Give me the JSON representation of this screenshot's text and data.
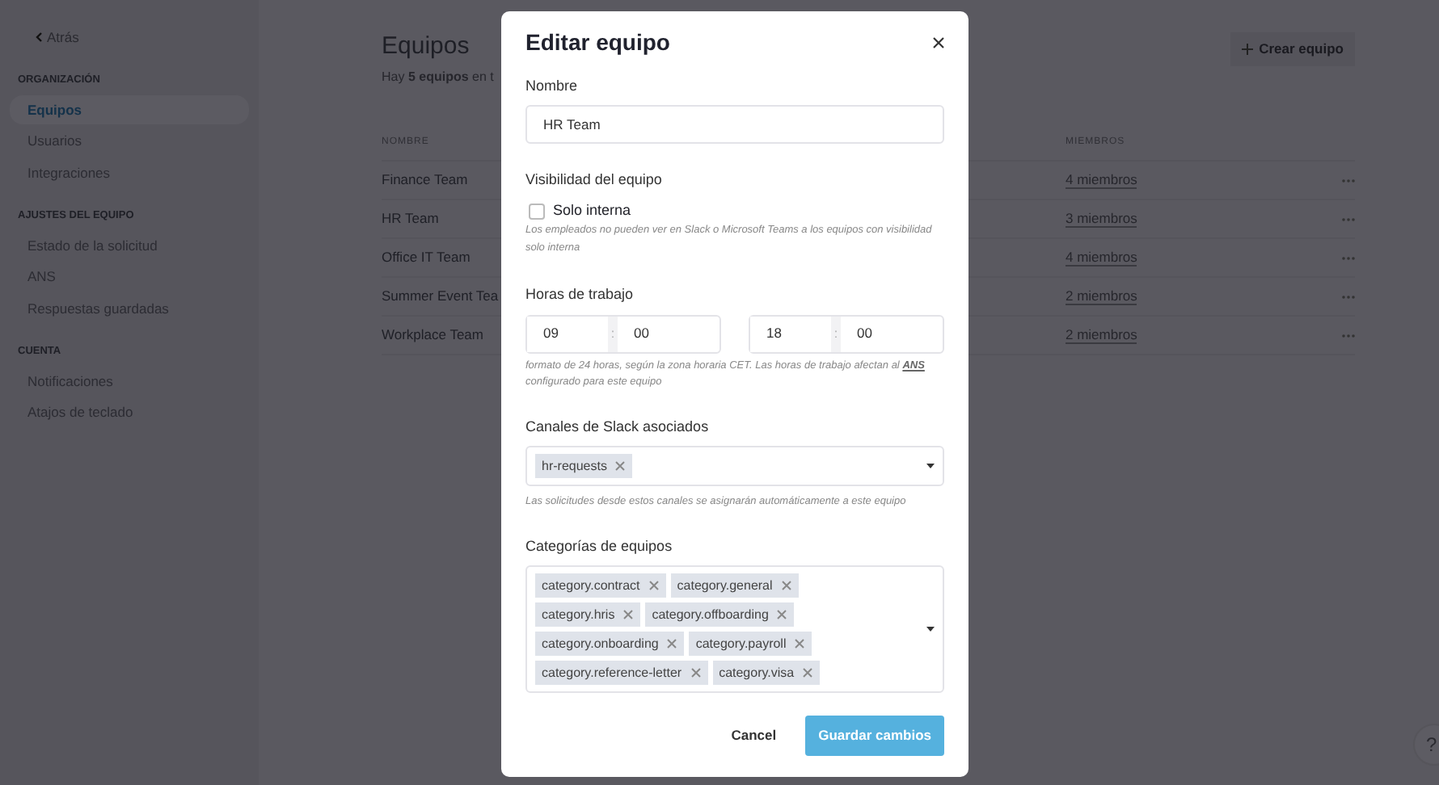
{
  "sidebar": {
    "back": "Atrás",
    "sections": [
      {
        "title": "ORGANIZACIÓN",
        "items": [
          {
            "label": "Equipos",
            "selected": true
          },
          {
            "label": "Usuarios",
            "selected": false
          },
          {
            "label": "Integraciones",
            "selected": false
          }
        ]
      },
      {
        "title": "AJUSTES DEL EQUIPO",
        "items": [
          {
            "label": "Estado de la solicitud",
            "selected": false
          },
          {
            "label": "ANS",
            "selected": false
          },
          {
            "label": "Respuestas guardadas",
            "selected": false
          }
        ]
      },
      {
        "title": "CUENTA",
        "items": [
          {
            "label": "Notificaciones",
            "selected": false
          },
          {
            "label": "Atajos de teclado",
            "selected": false
          }
        ]
      }
    ]
  },
  "main": {
    "title": "Equipos",
    "subtitle": "Hay **5 equipos** en t",
    "create_button": "Crear equipo",
    "table": {
      "columns": [
        "NOMBRE",
        "MIEMBROS"
      ],
      "rows": [
        {
          "name": "Finance Team",
          "members": "4 miembros"
        },
        {
          "name": "HR Team",
          "members": "3 miembros"
        },
        {
          "name": "Office IT Team",
          "members": "4 miembros"
        },
        {
          "name": "Summer Event Tea",
          "members": "2 miembros"
        },
        {
          "name": "Workplace Team",
          "members": "2 miembros"
        }
      ]
    }
  },
  "help_button": "?",
  "modal": {
    "title": "Editar equipo",
    "name_label": "Nombre",
    "name_value": "HR Team",
    "visibility_label": "Visibilidad del equipo",
    "internal_only": {
      "label": "Solo interna",
      "checked": false
    },
    "visibility_help": "Los empleados no pueden ver en Slack o Microsoft Teams a los equipos con visibilidad solo interna",
    "hours_label": "Horas de trabajo",
    "start": {
      "hour": "09",
      "separator": ":",
      "minute": "00"
    },
    "end": {
      "hour": "18",
      "separator": ":",
      "minute": "00"
    },
    "hours_help": {
      "before": "formato de 24 horas, según la zona horaria CET. Las horas de trabajo afectan al ",
      "link": "ANS",
      "after": " configurado para este equipo"
    },
    "slack_label": "Canales de Slack asociados",
    "slack_channels": [
      "hr-requests"
    ],
    "slack_help": "Las solicitudes desde estos canales se asignarán automáticamente a este equipo",
    "categories_label": "Categorías de equipos",
    "categories": [
      "category.contract",
      "category.general",
      "category.hris",
      "category.offboarding",
      "category.onboarding",
      "category.payroll",
      "category.reference-letter",
      "category.visa"
    ],
    "cancel": "Cancel",
    "save": "Guardar cambios"
  }
}
